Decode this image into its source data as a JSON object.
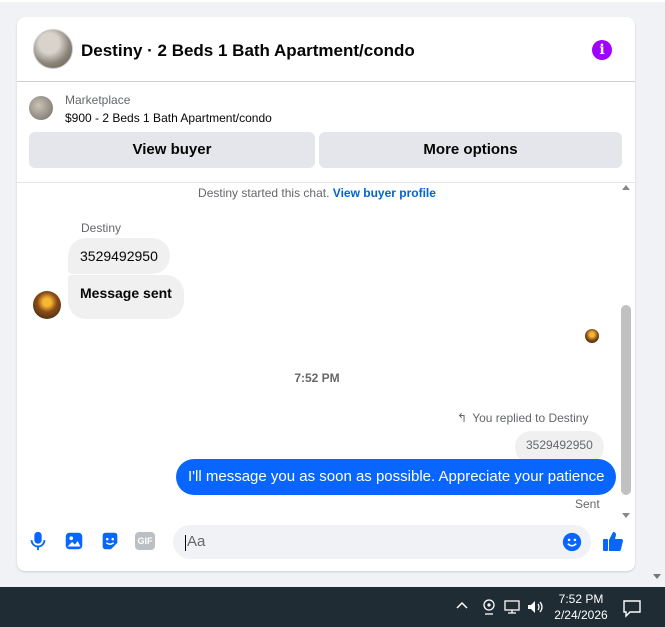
{
  "header": {
    "title": "Destiny · 2 Beds 1 Bath Apartment/condo",
    "info_icon": "info-icon"
  },
  "marketplace": {
    "label": "Marketplace",
    "item": "$900 - 2 Beds 1 Bath Apartment/condo",
    "view_buyer": "View buyer",
    "more_options": "More options"
  },
  "chat": {
    "started_text": "Destiny started this chat.",
    "view_profile": "View buyer profile",
    "sender_name": "Destiny",
    "messages_in": [
      "3529492950",
      "Message sent"
    ],
    "timestamp": "7:52 PM",
    "replied_to": "You replied to Destiny",
    "quoted_text": "3529492950",
    "message_out": "I'll message you as soon as possible. Appreciate your patience",
    "status": "Sent"
  },
  "composer": {
    "placeholder": "Aa",
    "gif_label": "GIF"
  },
  "taskbar": {
    "time": "7:52 PM",
    "date": "2/24/2026"
  },
  "colors": {
    "accent": "#0866ff",
    "info": "#a100ff",
    "taskbar": "#1f2c34"
  }
}
